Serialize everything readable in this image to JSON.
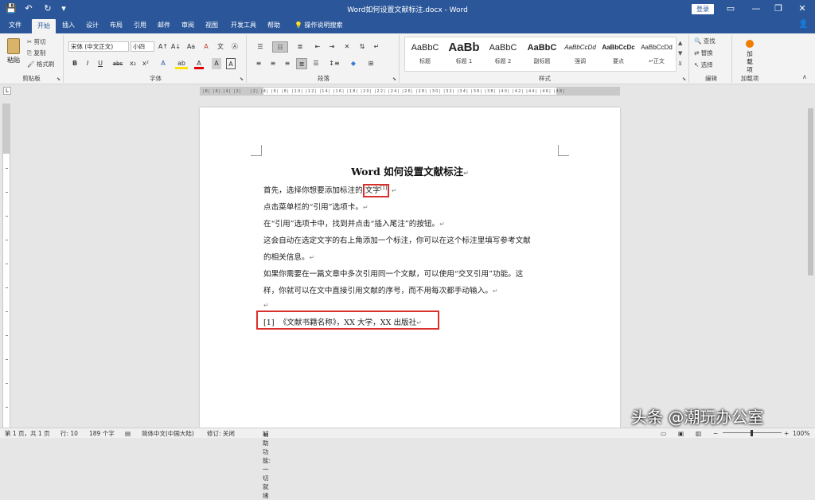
{
  "window": {
    "title": "Word如何设置文献标注.docx - Word",
    "login_label": "登录",
    "min": "—",
    "restore": "❐",
    "close": "✕",
    "ribbon_toggle": "▭"
  },
  "quick_access": {
    "save": "💾",
    "undo": "↶",
    "redo": "↻",
    "more": "▾"
  },
  "tabs": [
    "文件",
    "开始",
    "插入",
    "设计",
    "布局",
    "引用",
    "邮件",
    "审阅",
    "视图",
    "开发工具",
    "帮助"
  ],
  "tell_me": "操作说明搜索",
  "share_icon": "👤",
  "ribbon": {
    "clipboard": {
      "label": "剪贴板",
      "paste": "粘贴",
      "cut": "剪切",
      "copy": "复制",
      "format_painter": "格式刷"
    },
    "font": {
      "label": "字体",
      "font_name": "宋体 (中文正文)",
      "font_size": "小四",
      "grow": "A↑",
      "shrink": "A↓",
      "case": "Aa",
      "clear": "A",
      "bold": "B",
      "italic": "I",
      "underline": "U",
      "strike": "abc",
      "sub": "x₂",
      "sup": "x²",
      "effects": "A",
      "highlight": "ab",
      "color": "A",
      "charshade": "A",
      "border": "A"
    },
    "paragraph": {
      "label": "段落"
    },
    "styles": {
      "label": "样式",
      "items": [
        {
          "preview": "AaBbC",
          "name": "标题"
        },
        {
          "preview": "AaBb",
          "name": "标题 1"
        },
        {
          "preview": "AaBbC",
          "name": "标题 2"
        },
        {
          "preview": "AaBbC",
          "name": "副标题"
        },
        {
          "preview": "AaBbCcDd",
          "name": "强调"
        },
        {
          "preview": "AaBbCcDc",
          "name": "要点"
        },
        {
          "preview": "AaBbCcDd",
          "name": "↵正文"
        }
      ]
    },
    "editing": {
      "label": "编辑",
      "find": "查找",
      "replace": "替换",
      "select": "选择"
    },
    "addins": {
      "label": "加载项",
      "button": "加载项"
    }
  },
  "document": {
    "title": "Word 如何设置文献标注",
    "lines": [
      {
        "pre": "首先，选择你想要添加标注的",
        "boxed": "文字",
        "sup": "[1]"
      },
      {
        "text": "点击菜单栏的“引用”选项卡。"
      },
      {
        "text": "在“引用”选项卡中，找到并点击“插入尾注”的按钮。"
      },
      {
        "text": "这会自动在选定文字的右上角添加一个标注，你可以在这个标注里填写参考文献"
      },
      {
        "text": "的相关信息。"
      },
      {
        "text": "如果你需要在一篇文章中多次引用同一个文献，可以使用“交叉引用”功能。这"
      },
      {
        "text": "样，你就可以在文中直接引用文献的序号，而不用每次都手动输入。"
      },
      {
        "text": ""
      }
    ],
    "endnote": {
      "num": "[1]",
      "text": "《文献书籍名称》，XX 大学，XX 出版社"
    },
    "para_mark": "↵"
  },
  "status": {
    "page": "第 1 页，共 1 页",
    "line": "行: 10",
    "words": "189 个字",
    "language": "简体中文(中国大陆)",
    "track": "修订: 关闭",
    "accessibility": "辅助功能: 一切就绪",
    "zoom": "100%"
  },
  "watermark": "头条 @潮玩办公室"
}
